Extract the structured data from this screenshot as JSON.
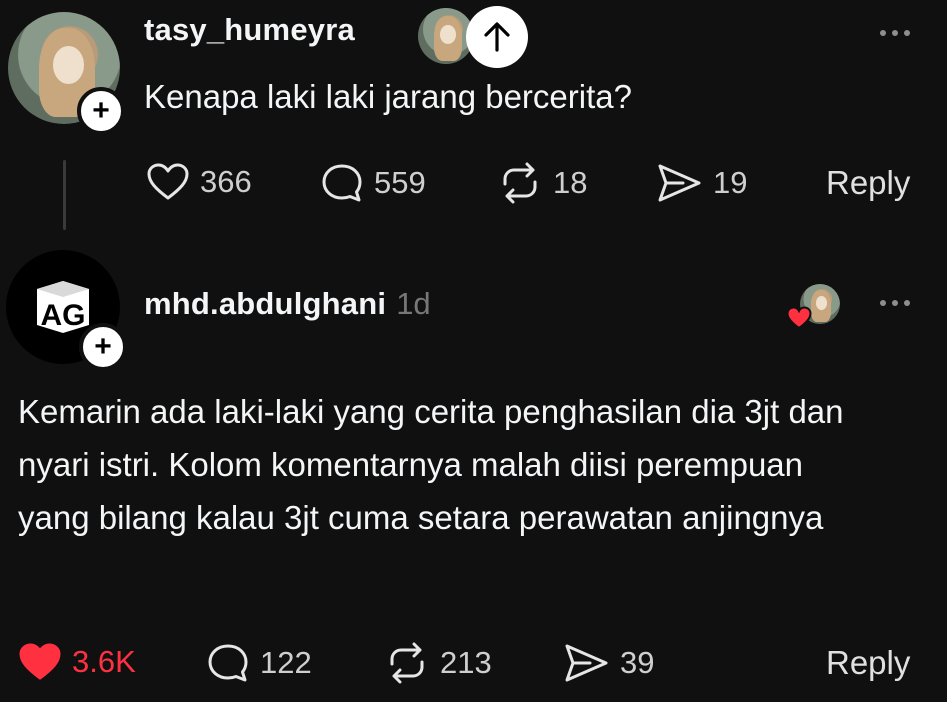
{
  "post": {
    "username": "tasy_humeyra",
    "text": "Kenapa laki laki jarang bercerita?",
    "likes": "366",
    "comments": "559",
    "reposts": "18",
    "shares": "19",
    "reply_label": "Reply"
  },
  "reply": {
    "username": "mhd.abdulghani",
    "time": "1d",
    "avatar_text": "AG",
    "text": "Kemarin ada laki-laki yang cerita penghasilan dia 3jt dan nyari istri. Kolom komentarnya malah diisi perempuan yang bilang kalau 3jt cuma setara perawatan anjingnya",
    "likes": "3.6K",
    "comments": "122",
    "reposts": "213",
    "shares": "39",
    "reply_label": "Reply",
    "liked": true
  },
  "icons": {
    "like": "heart-icon",
    "comment": "comment-bubble-icon",
    "repost": "repost-icon",
    "share": "share-send-icon",
    "more": "more-dots-icon",
    "follow": "plus-icon",
    "scroll_up": "arrow-up-icon"
  },
  "colors": {
    "background": "#101010",
    "text": "#f3f5f7",
    "muted": "#777777",
    "like_active": "#ff3040"
  }
}
